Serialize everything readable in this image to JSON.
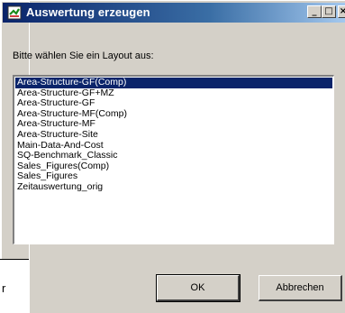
{
  "dialog": {
    "title": "Auswertung erzeugen",
    "minimize": "_",
    "maximize": "□",
    "close": "×",
    "prompt": "Bitte wählen Sie ein Layout aus:",
    "layouts": [
      "Area-Structure-GF(Comp)",
      "Area-Structure-GF+MZ",
      "Area-Structure-GF",
      "Area-Structure-MF(Comp)",
      "Area-Structure-MF",
      "Area-Structure-Site",
      "Main-Data-And-Cost",
      "SQ-Benchmark_Classic",
      "Sales_Figures(Comp)",
      "Sales_Figures",
      "Zeitauswertung_orig"
    ],
    "selected_index": 0,
    "ok_label": "OK",
    "cancel_label": "Abbrechen"
  },
  "background": {
    "fragment_letter": "r"
  },
  "colors": {
    "titlebar_start": "#0a246a",
    "titlebar_end": "#a6caf0",
    "face": "#d4d0c8",
    "selection": "#0a246a"
  }
}
